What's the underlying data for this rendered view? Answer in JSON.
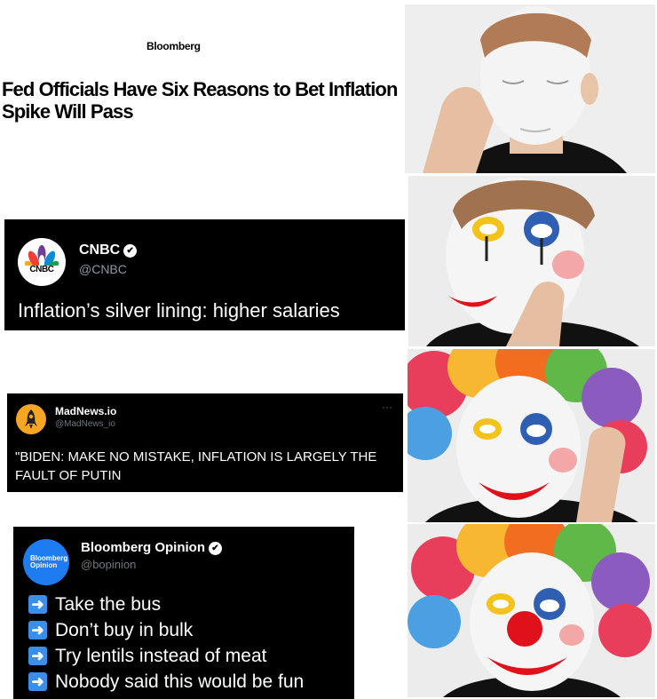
{
  "bloomberg_headline": {
    "brand": "Bloomberg",
    "headline": "Fed Officials Have Six Reasons to Bet Inflation Spike Will Pass"
  },
  "cnbc_tweet": {
    "logo_text": "CNBC",
    "name": "CNBC",
    "handle": "@CNBC",
    "text": "Inflation’s silver lining: higher salaries"
  },
  "madnews_tweet": {
    "name": "MadNews.io",
    "handle": "@MadNews_io",
    "menu": "···",
    "text": "\"BIDEN: MAKE NO MISTAKE, INFLATION IS LARGELY THE FAULT OF PUTIN"
  },
  "bloomberg_opinion_tweet": {
    "logo_text": "Bloomberg Opinion",
    "name": "Bloomberg Opinion",
    "handle": "@bopinion",
    "items": [
      "Take the bus",
      "Don’t buy in bulk",
      "Try lentils instead of meat",
      "Nobody said this would be fun"
    ]
  },
  "icons": {
    "verified": "verified-check-icon",
    "arrow": "right-arrow-icon"
  },
  "colors": {
    "tweet_background": "#000000",
    "bloomberg_opinion_blue": "#1e7bf0",
    "arrow_blue": "#3b8eea",
    "clown_red": "#e0111b"
  }
}
